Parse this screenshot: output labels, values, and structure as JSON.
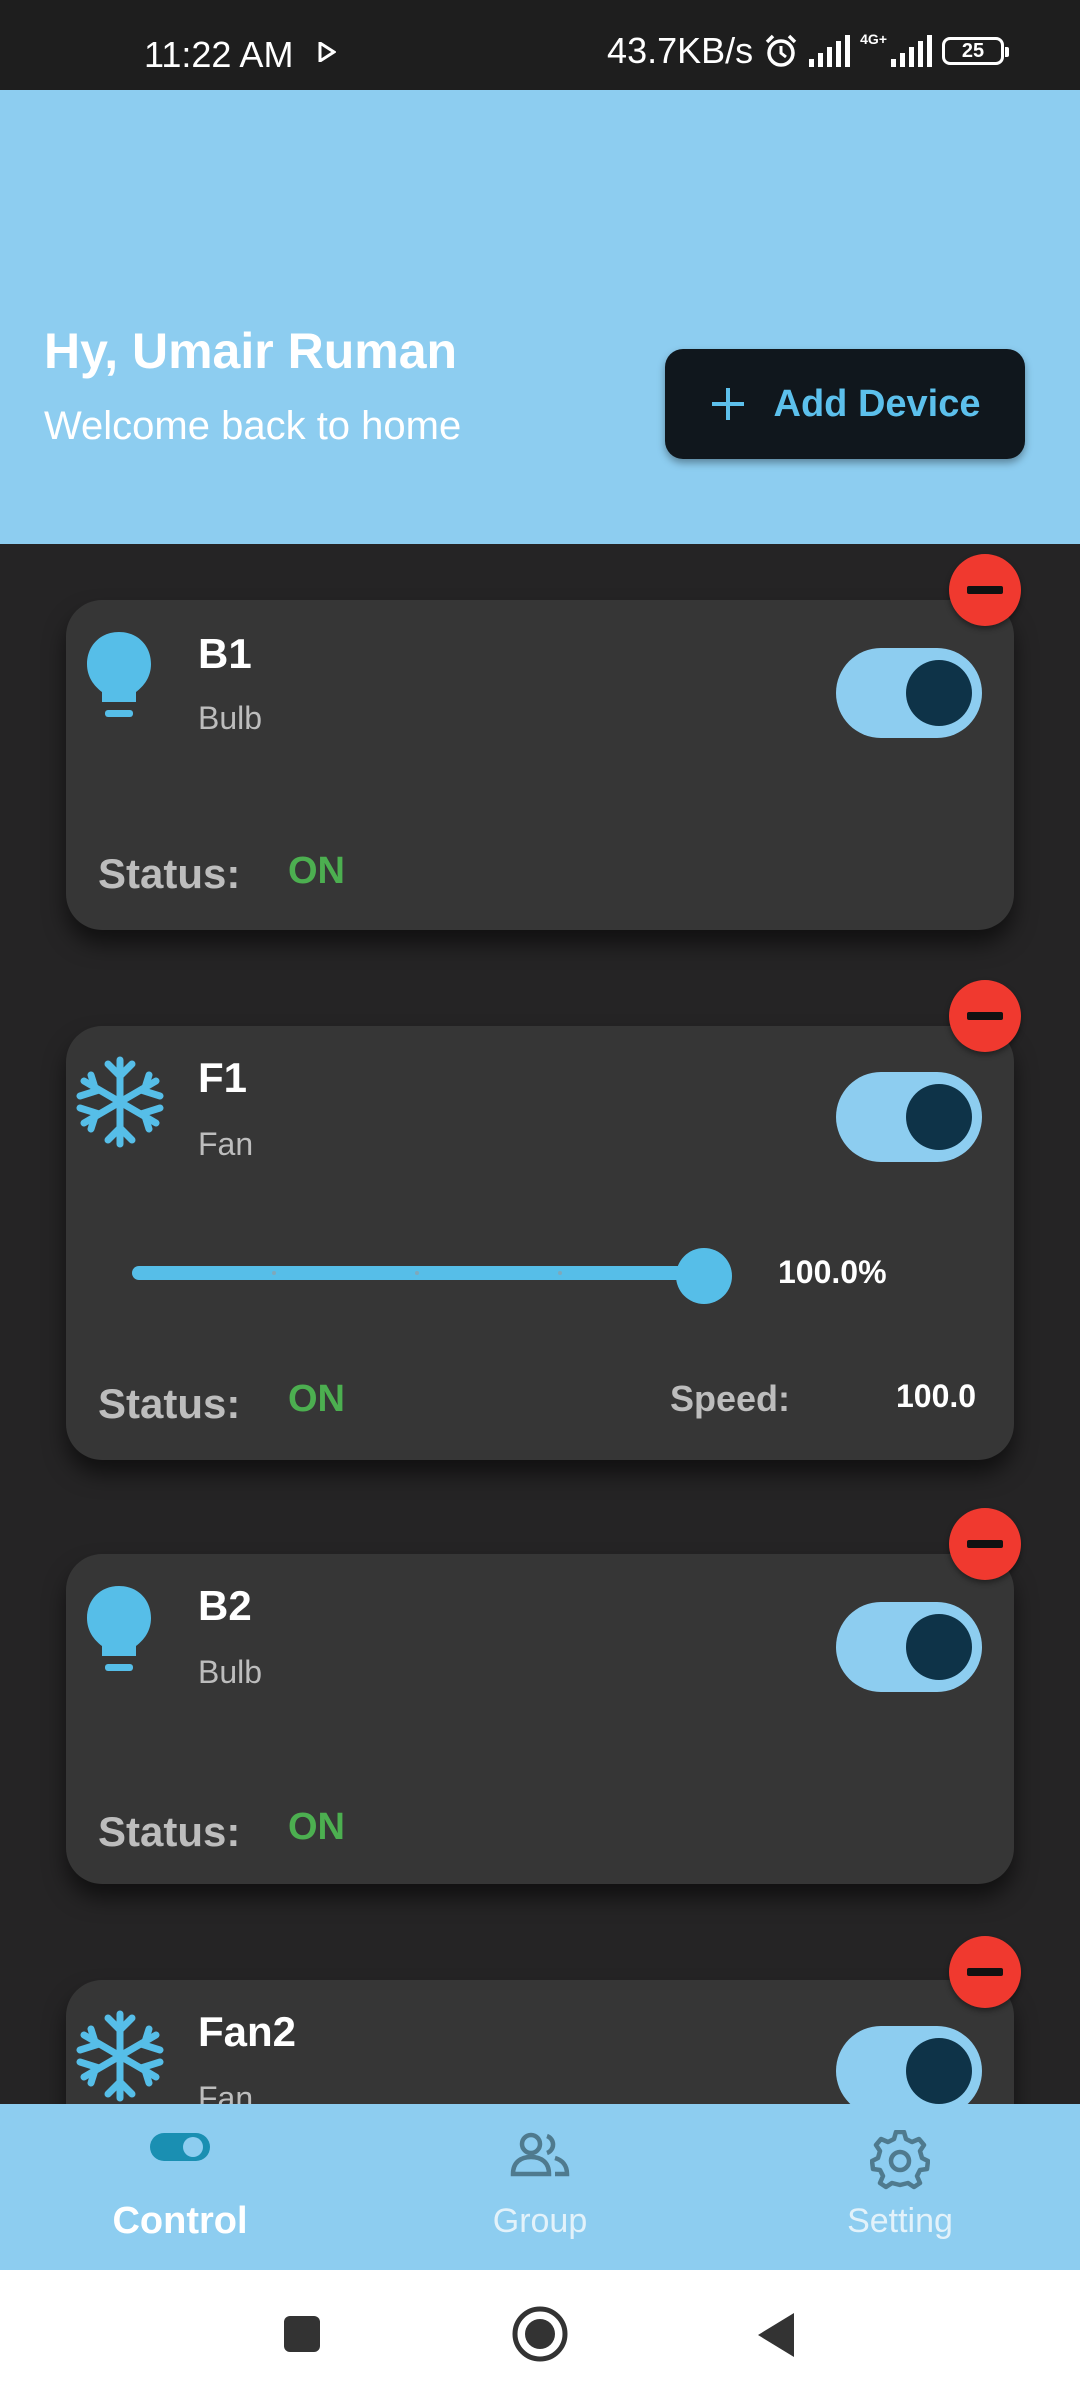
{
  "status_bar": {
    "time": "11:22 AM",
    "net_speed": "43.7KB/s",
    "network_type": "4G+",
    "battery": "25"
  },
  "header": {
    "greeting": "Hy, Umair Ruman",
    "subtitle": "Welcome back to home",
    "add_button_label": "Add Device"
  },
  "devices": [
    {
      "name": "B1",
      "type": "Bulb",
      "icon": "bulb-icon",
      "toggle_on": true,
      "status_label": "Status:",
      "status_value": "ON"
    },
    {
      "name": "F1",
      "type": "Fan",
      "icon": "snowflake-icon",
      "toggle_on": true,
      "status_label": "Status:",
      "status_value": "ON",
      "slider_value": 1.0,
      "slider_text": "100.0%",
      "speed_label": "Speed:",
      "speed_value": "100.0"
    },
    {
      "name": "B2",
      "type": "Bulb",
      "icon": "bulb-icon",
      "toggle_on": true,
      "status_label": "Status:",
      "status_value": "ON"
    },
    {
      "name": "Fan2",
      "type": "Fan",
      "icon": "snowflake-icon",
      "toggle_on": true
    }
  ],
  "bottom_nav": [
    {
      "label": "Control",
      "icon": "toggle-icon",
      "active": true
    },
    {
      "label": "Group",
      "icon": "group-icon",
      "active": false
    },
    {
      "label": "Setting",
      "icon": "gear-icon",
      "active": false
    }
  ],
  "colors": {
    "accent": "#56bee8",
    "header_bg": "#8dcdf0",
    "card_bg": "#363636",
    "page_bg": "#252425",
    "status_on": "#4caf50",
    "remove": "#f0392f"
  }
}
